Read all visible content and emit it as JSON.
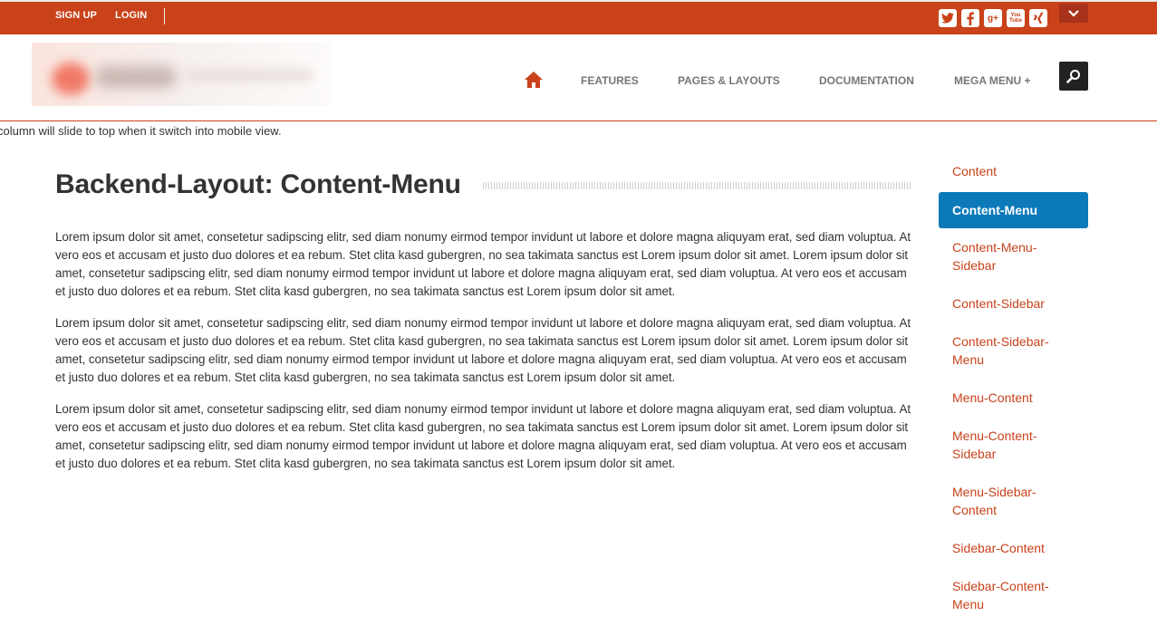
{
  "topbar": {
    "signup_label": "SIGN UP",
    "login_label": "LOGIN",
    "social_icons": [
      "twitter-icon",
      "facebook-icon",
      "google-plus-icon",
      "youtube-icon",
      "xing-icon"
    ],
    "youtube_text": "You Tube",
    "background_color": "#c9421a"
  },
  "header": {
    "nav": {
      "home_icon": "home-icon",
      "features_label": "FEATURES",
      "pages_layouts_label": "PAGES & LAYOUTS",
      "documentation_label": "DOCUMENTATION",
      "mega_menu_label": "MEGA MENU +"
    },
    "search_icon": "search-icon"
  },
  "notice_text": "column will slide to top when it switch into mobile view.",
  "main": {
    "title": "Backend-Layout: Content-Menu",
    "paragraphs": [
      "Lorem ipsum dolor sit amet, consetetur sadipscing elitr, sed diam nonumy eirmod tempor invidunt ut labore et dolore magna aliquyam erat, sed diam voluptua. At vero eos et accusam et justo duo dolores et ea rebum. Stet clita kasd gubergren, no sea takimata sanctus est Lorem ipsum dolor sit amet. Lorem ipsum dolor sit amet, consetetur sadipscing elitr, sed diam nonumy eirmod tempor invidunt ut labore et dolore magna aliquyam erat, sed diam voluptua. At vero eos et accusam et justo duo dolores et ea rebum. Stet clita kasd gubergren, no sea takimata sanctus est Lorem ipsum dolor sit amet.",
      "Lorem ipsum dolor sit amet, consetetur sadipscing elitr, sed diam nonumy eirmod tempor invidunt ut labore et dolore magna aliquyam erat, sed diam voluptua. At vero eos et accusam et justo duo dolores et ea rebum. Stet clita kasd gubergren, no sea takimata sanctus est Lorem ipsum dolor sit amet. Lorem ipsum dolor sit amet, consetetur sadipscing elitr, sed diam nonumy eirmod tempor invidunt ut labore et dolore magna aliquyam erat, sed diam voluptua. At vero eos et accusam et justo duo dolores et ea rebum. Stet clita kasd gubergren, no sea takimata sanctus est Lorem ipsum dolor sit amet.",
      "Lorem ipsum dolor sit amet, consetetur sadipscing elitr, sed diam nonumy eirmod tempor invidunt ut labore et dolore magna aliquyam erat, sed diam voluptua. At vero eos et accusam et justo duo dolores et ea rebum. Stet clita kasd gubergren, no sea takimata sanctus est Lorem ipsum dolor sit amet. Lorem ipsum dolor sit amet, consetetur sadipscing elitr, sed diam nonumy eirmod tempor invidunt ut labore et dolore magna aliquyam erat, sed diam voluptua. At vero eos et accusam et justo duo dolores et ea rebum. Stet clita kasd gubergren, no sea takimata sanctus est Lorem ipsum dolor sit amet."
    ]
  },
  "sidebar": {
    "active_color": "#0c7ab9",
    "link_color": "#c9421a",
    "items": [
      {
        "label": "Content"
      },
      {
        "label": "Content-Menu",
        "active": true
      },
      {
        "label": "Content-Menu-Sidebar"
      },
      {
        "label": "Content-Sidebar"
      },
      {
        "label": "Content-Sidebar-Menu"
      },
      {
        "label": "Menu-Content"
      },
      {
        "label": "Menu-Content-Sidebar"
      },
      {
        "label": "Menu-Sidebar-Content"
      },
      {
        "label": "Sidebar-Content"
      },
      {
        "label": "Sidebar-Content-Menu"
      }
    ]
  }
}
